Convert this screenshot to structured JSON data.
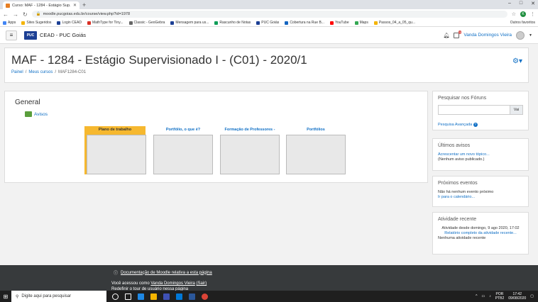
{
  "browser": {
    "tab_title": "Curso: MAF - 1284 - Estágio Sup...",
    "url": "moodle.pucgoias.edu.br/course/view.php?id=1978",
    "profile_initial": "K",
    "bookmarks": [
      {
        "label": "Apps",
        "color": "#4285f4"
      },
      {
        "label": "Sites Sugeridos",
        "color": "#f4b400"
      },
      {
        "label": "Login CEAD",
        "color": "#1c3f94"
      },
      {
        "label": "MathType for Tiny...",
        "color": "#d93025"
      },
      {
        "label": "Classic - GeoGebra",
        "color": "#666666"
      },
      {
        "label": "Mensagem para us...",
        "color": "#1c3f94"
      },
      {
        "label": "Rascunho de Notas",
        "color": "#0f9d58"
      },
      {
        "label": "PUC Goiás",
        "color": "#1c3f94"
      },
      {
        "label": "Cobertura na Rue B...",
        "color": "#1565c0"
      },
      {
        "label": "YouTube",
        "color": "#ff0000"
      },
      {
        "label": "Maps",
        "color": "#34a853"
      },
      {
        "label": "Passos_04_a_05_qu...",
        "color": "#f4b400"
      }
    ],
    "bookmarks_other": "Outros favoritos"
  },
  "navbar": {
    "logo_text": "PUC",
    "site_name": "CEAD - PUC Goiás",
    "messages_count": "1",
    "user_name": "Vanda Domingos Vieira"
  },
  "header": {
    "title": "MAF - 1284 - Estágio Supervisionado I - (C01) - 2020/1",
    "breadcrumb": [
      "Painel",
      "Meus cursos",
      "MAF1284-C01"
    ]
  },
  "main": {
    "section_title": "General",
    "forum_label": "Avisos",
    "tiles": [
      {
        "label": "Plano de trabalho",
        "active": true
      },
      {
        "label": "Portfólio, o que é?",
        "active": false
      },
      {
        "label": "Formação de Professores -",
        "active": false
      },
      {
        "label": "Portfólios",
        "active": false
      }
    ]
  },
  "blocks": {
    "search": {
      "title": "Pesquisar nos Fóruns",
      "button": "Vai",
      "advanced": "Pesquisa Avançada"
    },
    "news": {
      "title": "Últimos avisos",
      "add_link": "Acrescentar um novo tópico...",
      "empty": "(Nenhum aviso publicado.)"
    },
    "events": {
      "title": "Próximos eventos",
      "empty": "Não há nenhum evento próximo",
      "calendar_link": "Ir para o calendário..."
    },
    "activity": {
      "title": "Atividade recente",
      "since": "Atividade desde domingo, 9 ago 2020, 17:02",
      "report_link": "Relatório completo da atividade recente...",
      "empty": "Nenhuma atividade recente"
    }
  },
  "footer": {
    "doc_link": "Documentação de Moodle relativa a esta página",
    "logged_prefix": "Você acessou como",
    "user_link": "Vanda Domingos Vieira",
    "logout_link": "(Sair)",
    "tour": "Redefinir o tour de usuário nessa página"
  },
  "taskbar": {
    "search_placeholder": "Digite aqui para pesquisar",
    "lang": "POR",
    "layout": "PTB2",
    "time": "17:42",
    "date": "09/08/2020"
  }
}
